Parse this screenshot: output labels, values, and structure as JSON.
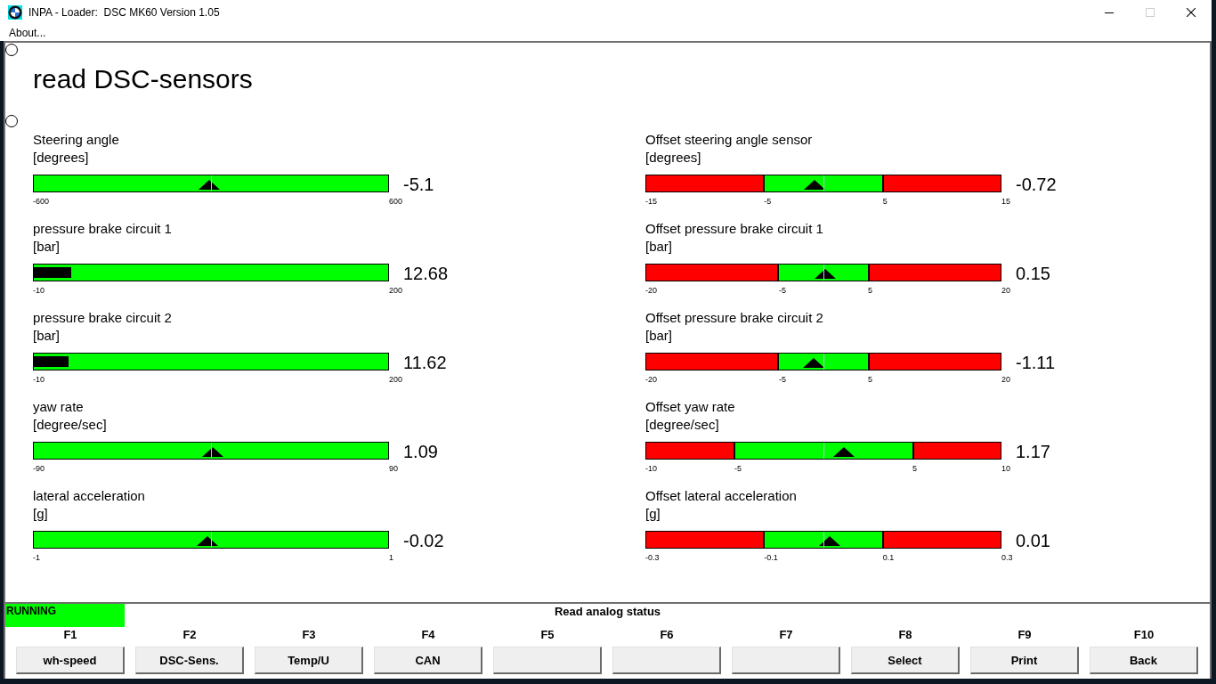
{
  "window": {
    "title": "INPA - Loader:  DSC MK60 Version 1.05",
    "maximize_disabled": true
  },
  "menu": [
    "About..."
  ],
  "heading": "read DSC-sensors",
  "gauges": [
    {
      "label": "Steering angle",
      "unit": "[degrees]",
      "kind": "pointer",
      "level": 0.496,
      "reading": "-5.1",
      "ticks": [
        "-600",
        "600"
      ]
    },
    {
      "label": "Offset steering angle sensor",
      "unit": "[degrees]",
      "kind": "pointer",
      "level": 0.476,
      "reading": "-0.72",
      "low_zone": {
        "level": 0.333
      },
      "high_zone": {
        "level": 0.333
      },
      "ticks": [
        "-15",
        "-5",
        "5",
        "15"
      ]
    },
    {
      "label": "pressure brake circuit 1",
      "unit": "[bar]",
      "kind": "bar",
      "level": 0.108,
      "reading": "12.68",
      "ticks": [
        "-10",
        "200"
      ]
    },
    {
      "label": "Offset pressure brake circuit 1",
      "unit": "[bar]",
      "kind": "pointer",
      "level": 0.504,
      "reading": "0.15",
      "low_zone": {
        "level": 0.375
      },
      "high_zone": {
        "level": 0.375
      },
      "ticks": [
        "-20",
        "-5",
        "5",
        "20"
      ]
    },
    {
      "label": "pressure brake circuit 2",
      "unit": "[bar]",
      "kind": "bar",
      "level": 0.101,
      "reading": "11.62",
      "ticks": [
        "-10",
        "200"
      ]
    },
    {
      "label": "Offset pressure brake circuit 2",
      "unit": "[bar]",
      "kind": "pointer",
      "level": 0.472,
      "reading": "-1.11",
      "low_zone": {
        "level": 0.375
      },
      "high_zone": {
        "level": 0.375
      },
      "ticks": [
        "-20",
        "-5",
        "5",
        "20"
      ]
    },
    {
      "label": "yaw rate",
      "unit": "[degree/sec]",
      "kind": "pointer",
      "level": 0.506,
      "reading": "1.09",
      "ticks": [
        "-90",
        "90"
      ]
    },
    {
      "label": "Offset yaw rate",
      "unit": "[degree/sec]",
      "kind": "pointer",
      "level": 0.559,
      "reading": "1.17",
      "low_zone": {
        "level": 0.25
      },
      "high_zone": {
        "level": 0.25
      },
      "ticks": [
        "-10",
        "-5",
        "5",
        "10"
      ]
    },
    {
      "label": "lateral acceleration",
      "unit": "[g]",
      "kind": "pointer",
      "level": 0.49,
      "reading": "-0.02",
      "ticks": [
        "-1",
        "1"
      ]
    },
    {
      "label": "Offset lateral acceleration",
      "unit": "[g]",
      "kind": "pointer",
      "level": 0.517,
      "reading": "0.01",
      "low_zone": {
        "level": 0.333
      },
      "high_zone": {
        "level": 0.333
      },
      "ticks": [
        "-0.3",
        "-0.1",
        "0.1",
        "0.3"
      ]
    }
  ],
  "status": {
    "state": "RUNNING",
    "message": "Read analog status"
  },
  "function_keys": [
    {
      "key": "F1",
      "label": "wh-speed"
    },
    {
      "key": "F2",
      "label": "DSC-Sens."
    },
    {
      "key": "F3",
      "label": "Temp/U"
    },
    {
      "key": "F4",
      "label": "CAN"
    },
    {
      "key": "F5"
    },
    {
      "key": "F6"
    },
    {
      "key": "F7"
    },
    {
      "key": "F8",
      "label": "Select"
    },
    {
      "key": "F9",
      "label": "Print"
    },
    {
      "key": "F10",
      "label": "Back"
    }
  ]
}
